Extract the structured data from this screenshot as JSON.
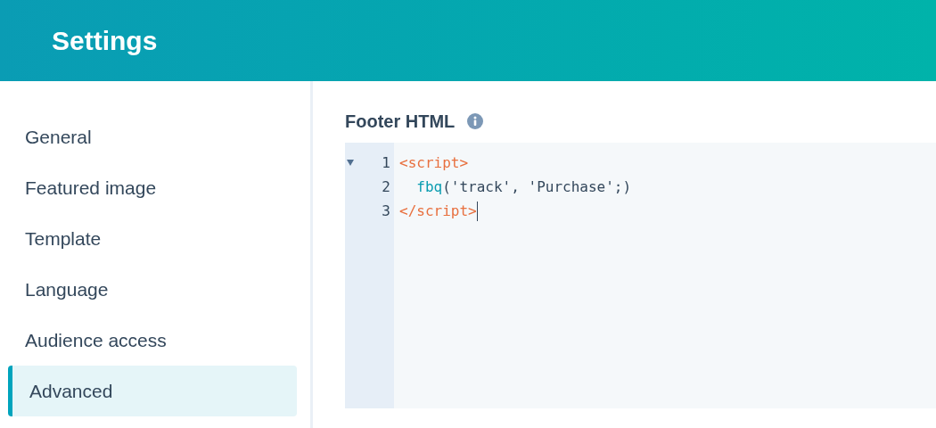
{
  "header": {
    "title": "Settings"
  },
  "sidebar": {
    "items": [
      {
        "label": "General",
        "selected": false
      },
      {
        "label": "Featured image",
        "selected": false
      },
      {
        "label": "Template",
        "selected": false
      },
      {
        "label": "Language",
        "selected": false
      },
      {
        "label": "Audience access",
        "selected": false
      },
      {
        "label": "Advanced",
        "selected": true
      }
    ]
  },
  "editor": {
    "label": "Footer HTML",
    "lines": [
      {
        "number": "1",
        "fold": true,
        "cursor": false,
        "tokens": [
          {
            "kind": "tag",
            "text": "<script>"
          }
        ]
      },
      {
        "number": "2",
        "fold": false,
        "cursor": false,
        "tokens": [
          {
            "kind": "func",
            "text": "  fbq"
          },
          {
            "kind": "plain",
            "text": "('track', 'Purchase';)"
          }
        ]
      },
      {
        "number": "3",
        "fold": false,
        "cursor": true,
        "tokens": [
          {
            "kind": "tag",
            "text": "</script>"
          }
        ]
      }
    ]
  }
}
